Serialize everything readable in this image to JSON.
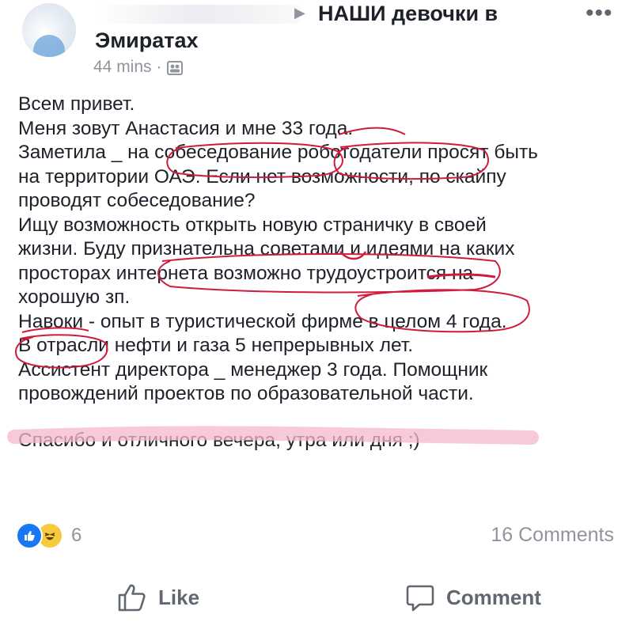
{
  "post_header": {
    "group_name_line1": "НАШИ девочки в",
    "group_name_line2": "Эмиратах",
    "time": "44 mins",
    "separator": "·",
    "more_label": "•••",
    "arrow_icon": "triangle-right-icon",
    "group_icon": "group-icon"
  },
  "post_body": {
    "lines": [
      "Всем привет.",
      "Меня зовут Анастасия и мне 33 года.",
      "Заметила _ на собеседование роботодатели просят быть",
      "на территории ОАЭ. Если нет возможности, по скайпу",
      "проводят собеседование?",
      "Ищу возможность открыть новую страничку в своей",
      "жизни. Буду признательна советами и идеями на каких",
      "просторах интернета возможно трудоустроится на",
      "хорошую зп.",
      "Навоки - опыт в туристической фирме в целом 4 года.",
      "В отрасли нефти  и газа 5 непрерывных лет.",
      "Ассистент директора _ менеджер 3 года. Помощник",
      "провождений проектов по образовательной части."
    ],
    "closing": "Спасибо и отличного вечера, утра или дня ;)"
  },
  "annotations": {
    "circle_color": "#d01c3c",
    "highlight_color": "#f5b8cb"
  },
  "reactions": {
    "count": "6",
    "types": [
      "like",
      "haha"
    ],
    "like_color": "#1877f2",
    "haha_color": "#f7c93e"
  },
  "comments": {
    "count_label": "16 Comments"
  },
  "actions": {
    "like_label": "Like",
    "comment_label": "Comment",
    "like_icon": "thumbs-up-icon",
    "comment_icon": "speech-bubble-icon"
  }
}
